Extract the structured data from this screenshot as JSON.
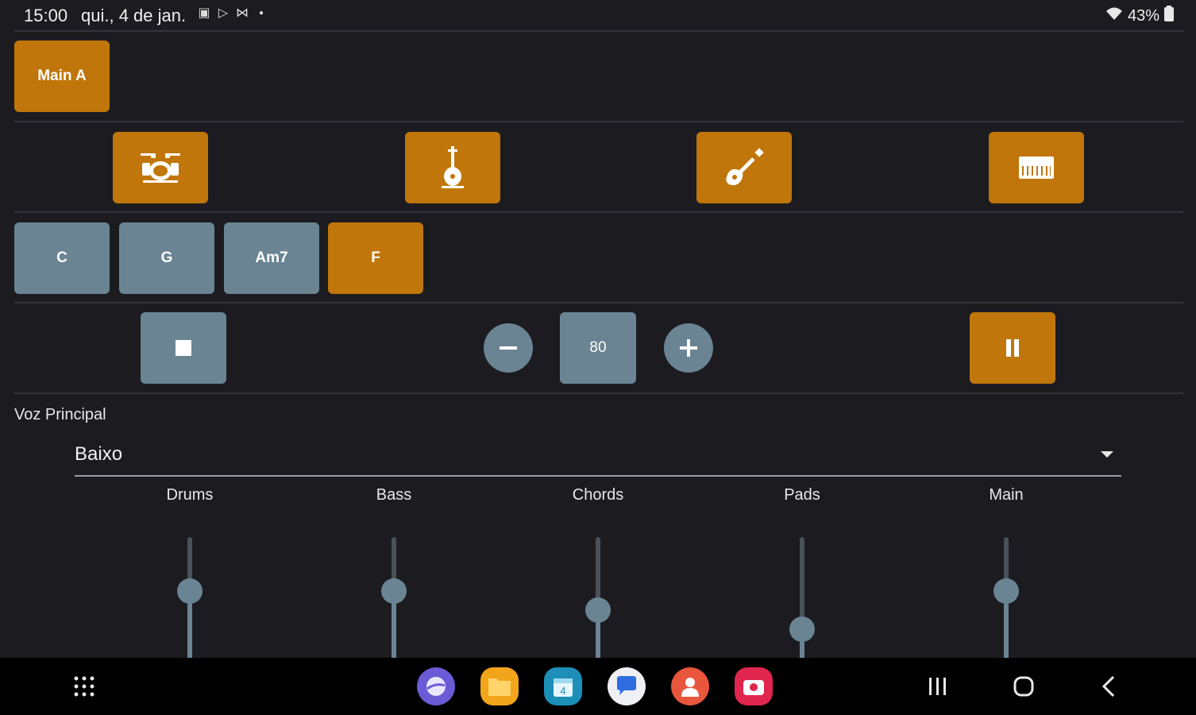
{
  "status_bar": {
    "time": "15:00",
    "date": "qui., 4 de jan.",
    "notification_icons": [
      "gallery-icon",
      "play-icon",
      "mail-icon",
      "dot-icon"
    ],
    "battery": "43%"
  },
  "style": {
    "label": "Main A",
    "color": "#c0760a"
  },
  "instruments": [
    {
      "name": "drums-icon"
    },
    {
      "name": "bass-icon"
    },
    {
      "name": "guitar-icon"
    },
    {
      "name": "keyboard-icon"
    }
  ],
  "chords": [
    {
      "label": "C",
      "active": false
    },
    {
      "label": "G",
      "active": false
    },
    {
      "label": "Am7",
      "active": false
    },
    {
      "label": "F",
      "active": true
    }
  ],
  "transport": {
    "tempo": "80"
  },
  "voice": {
    "label": "Voz Principal",
    "selected": "Baixo"
  },
  "mixer": [
    {
      "label": "Drums",
      "level": 0.71
    },
    {
      "label": "Bass",
      "level": 0.71
    },
    {
      "label": "Chords",
      "level": 0.49
    },
    {
      "label": "Pads",
      "level": 0.27
    },
    {
      "label": "Main",
      "level": 0.71
    }
  ],
  "colors": {
    "accent": "#c0760a",
    "secondary": "#6a8494",
    "background": "#1c1c20"
  }
}
